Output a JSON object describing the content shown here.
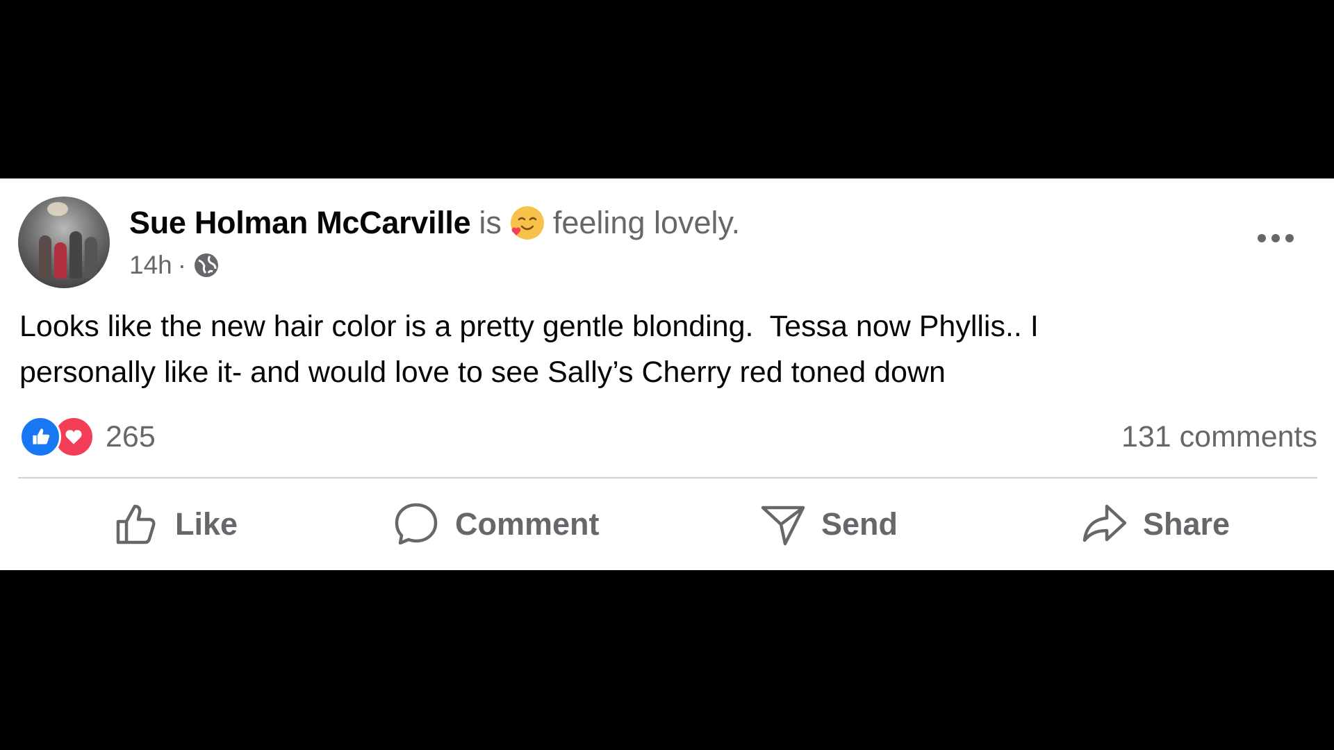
{
  "post": {
    "author": "Sue Holman McCarville",
    "is_word": "is",
    "feeling_icon": "smiling-face-with-heart-icon",
    "feeling_text": "feeling lovely.",
    "time": "14h",
    "separator": "·",
    "audience_icon": "globe-icon",
    "body": "Looks like the new hair color is a pretty gentle blonding.  Tessa now Phyllis.. I\npersonally like it- and would love to see Sally’s Cherry red toned down",
    "reactions": {
      "icons": [
        "like-reaction-icon",
        "love-reaction-icon"
      ],
      "count": "265"
    },
    "comments_count": "131 comments"
  },
  "actions": {
    "like": "Like",
    "comment": "Comment",
    "send": "Send",
    "share": "Share"
  },
  "colors": {
    "like_blue": "#1877f2",
    "love_red": "#f33e58",
    "secondary_text": "#65676b",
    "primary_text": "#050505"
  }
}
